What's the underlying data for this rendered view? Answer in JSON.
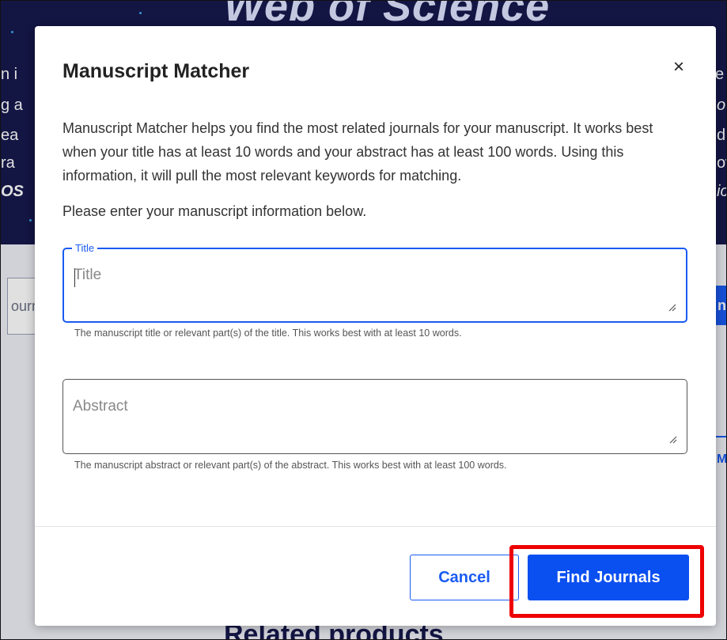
{
  "background": {
    "hero_title": "Web of Science",
    "left_fragments": [
      "n i",
      "g a",
      "ea",
      "ra",
      "OS"
    ],
    "right_fragments": [
      "e i",
      "o c",
      "de",
      "ow",
      "ic"
    ],
    "search_fragment": "ourr",
    "search_button_fragment": "n J",
    "right_link_fragment": "M",
    "related_products": "Related products"
  },
  "modal": {
    "title": "Manuscript Matcher",
    "close_symbol": "×",
    "description": "Manuscript Matcher helps you find the most related journals for your manuscript. It works best when your title has at least 10 words and your abstract has at least 100 words. Using this information, it will pull the most relevant keywords for matching.",
    "instruction": "Please enter your manuscript information below.",
    "title_field": {
      "label": "Title",
      "placeholder": "Title",
      "value": "",
      "hint": "The manuscript title or relevant part(s) of the title. This works best with at least 10 words."
    },
    "abstract_field": {
      "placeholder": "Abstract",
      "value": "",
      "hint": "The manuscript abstract or relevant part(s) of the abstract. This works best with at least 100 words."
    },
    "cancel_label": "Cancel",
    "find_label": "Find Journals"
  },
  "colors": {
    "accent": "#1a5bf2",
    "hero_background": "#16194d",
    "highlight": "#ee0000"
  }
}
